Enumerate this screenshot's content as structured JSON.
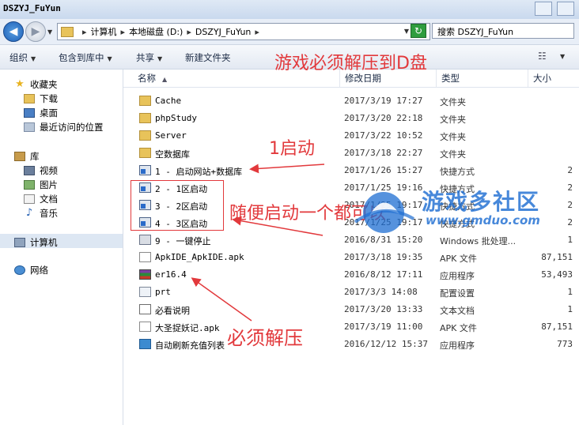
{
  "window": {
    "title": "DSZYJ_FuYun"
  },
  "address": {
    "crumbs": [
      "计算机",
      "本地磁盘 (D:)",
      "DSZYJ_FuYun"
    ],
    "search_placeholder": "搜索 DSZYJ_FuYun"
  },
  "toolbar": {
    "organize": "组织",
    "include_in_library": "包含到库中",
    "share": "共享",
    "new_folder": "新建文件夹"
  },
  "sidebar": {
    "favorites": "收藏夹",
    "downloads": "下载",
    "desktop": "桌面",
    "recent": "最近访问的位置",
    "libraries": "库",
    "videos": "视频",
    "pictures": "图片",
    "documents": "文档",
    "music": "音乐",
    "computer": "计算机",
    "network": "网络"
  },
  "columns": {
    "name": "名称",
    "date": "修改日期",
    "type": "类型",
    "size": "大小"
  },
  "files": [
    {
      "name": "Cache",
      "date": "2017/3/19 17:27",
      "type": "文件夹",
      "size": "",
      "icon": "folder-icon"
    },
    {
      "name": "phpStudy",
      "date": "2017/3/20 22:18",
      "type": "文件夹",
      "size": "",
      "icon": "folder-icon"
    },
    {
      "name": "Server",
      "date": "2017/3/22 10:52",
      "type": "文件夹",
      "size": "",
      "icon": "folder-icon"
    },
    {
      "name": "空数据库",
      "date": "2017/3/18 22:27",
      "type": "文件夹",
      "size": "",
      "icon": "folder-icon"
    },
    {
      "name": "1 - 启动网站+数据库",
      "date": "2017/1/26 15:27",
      "type": "快捷方式",
      "size": "2",
      "icon": "shortcut-icon"
    },
    {
      "name": "2 - 1区启动",
      "date": "2017/1/25 19:16",
      "type": "快捷方式",
      "size": "2",
      "icon": "shortcut-icon"
    },
    {
      "name": "3 - 2区启动",
      "date": "2017/1/25 19:17",
      "type": "快捷方式",
      "size": "2",
      "icon": "shortcut-icon"
    },
    {
      "name": "4 - 3区启动",
      "date": "2017/1/25 19:17",
      "type": "快捷方式",
      "size": "2",
      "icon": "shortcut-icon"
    },
    {
      "name": "9 - 一键停止",
      "date": "2016/8/31 15:20",
      "type": "Windows 批处理...",
      "size": "1",
      "icon": "batch-icon"
    },
    {
      "name": "ApkIDE_ApkIDE.apk",
      "date": "2017/3/18 19:35",
      "type": "APK 文件",
      "size": "87,151",
      "icon": "file-icon"
    },
    {
      "name": "er16.4",
      "date": "2016/8/12 17:11",
      "type": "应用程序",
      "size": "53,493",
      "icon": "winrar-icon"
    },
    {
      "name": "prt",
      "date": "2017/3/3 14:08",
      "type": "配置设置",
      "size": "1",
      "icon": "config-icon"
    },
    {
      "name": "必看说明",
      "date": "2017/3/20 13:33",
      "type": "文本文档",
      "size": "1",
      "icon": "text-icon"
    },
    {
      "name": "大圣捉妖记.apk",
      "date": "2017/3/19 11:00",
      "type": "APK 文件",
      "size": "87,151",
      "icon": "file-icon"
    },
    {
      "name": "自动刷新充值列表",
      "date": "2016/12/12 15:37",
      "type": "应用程序",
      "size": "773",
      "icon": "app-list-icon"
    }
  ],
  "annotations": {
    "unzip_to_d": "游戏必须解压到D盘",
    "start_first": "1启动",
    "any_start": "随便启动一个都可以",
    "must_unzip": "必须解压"
  },
  "watermark": {
    "text": "游戏多社区",
    "url": "www.gmduo.com"
  },
  "colors": {
    "annotation": "#e2393c",
    "watermark": "#1e6ed2",
    "selection": "#dde7f3"
  }
}
